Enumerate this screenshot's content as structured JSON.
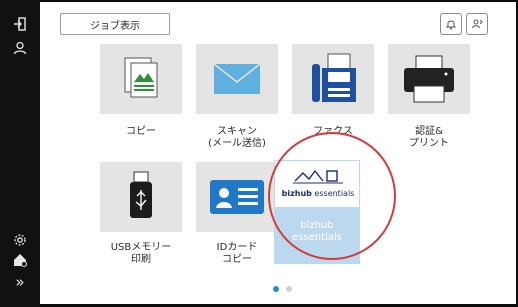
{
  "header": {
    "job_display_label": "ジョブ表示"
  },
  "top_icons": [
    "bell-icon",
    "user-switch-icon"
  ],
  "sidebar_icons": [
    "logout-icon",
    "person-icon",
    "settings-icon",
    "home-user-icon",
    "expand-icon"
  ],
  "apps": [
    {
      "id": "copy",
      "label": "コピー",
      "icon": "copy-icon"
    },
    {
      "id": "scan",
      "label": "スキャン\n(メール送信)",
      "icon": "envelope-icon"
    },
    {
      "id": "fax",
      "label": "ファクス",
      "icon": "fax-icon"
    },
    {
      "id": "auth-print",
      "label": "認証&\nプリント",
      "icon": "printer-icon"
    },
    {
      "id": "usb-print",
      "label": "USBメモリー\n印刷",
      "icon": "usb-icon"
    },
    {
      "id": "id-copy",
      "label": "IDカード\nコピー",
      "icon": "id-card-icon"
    }
  ],
  "bizhub": {
    "label": "bizhub\nessentials",
    "logo_text_bold": "bizhub",
    "logo_text_light": " essentials"
  },
  "pagination": {
    "current": 1,
    "total": 2
  },
  "colors": {
    "highlight_ring": "#d43a3a",
    "active_dot": "#1f8fd6",
    "bizhub_tile": "#bcd8ee"
  }
}
